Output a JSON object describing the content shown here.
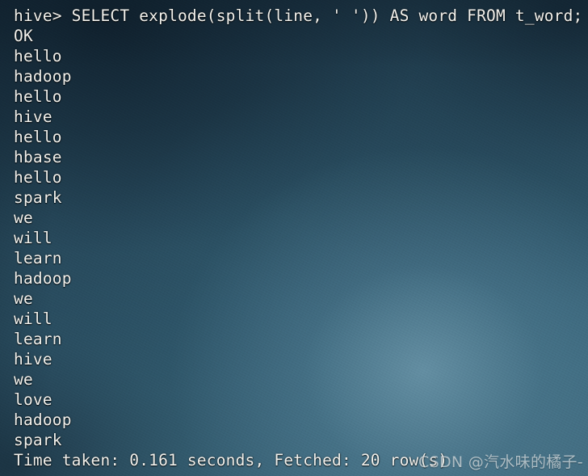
{
  "terminal": {
    "app": "hive-cli",
    "prompt": "hive>",
    "background_color": "#2f586b",
    "text_color": "#f2f1ec",
    "lines": [
      "hive> SELECT explode(split(line, ' ')) AS word FROM t_word;",
      "OK",
      "hello",
      "hadoop",
      "hello",
      "hive",
      "hello",
      "hbase",
      "hello",
      "spark",
      "we",
      "will",
      "learn",
      "hadoop",
      "we",
      "will",
      "learn",
      "hive",
      "we",
      "love",
      "hadoop",
      "spark",
      "Time taken: 0.161 seconds, Fetched: 20 row(s)"
    ],
    "query": "SELECT explode(split(line, ' ')) AS word FROM t_word;",
    "status": "OK",
    "result_words": [
      "hello",
      "hadoop",
      "hello",
      "hive",
      "hello",
      "hbase",
      "hello",
      "spark",
      "we",
      "will",
      "learn",
      "hadoop",
      "we",
      "will",
      "learn",
      "hive",
      "we",
      "love",
      "hadoop",
      "spark"
    ],
    "summary": {
      "time_taken_seconds": "0.161",
      "fetched_rows": "20",
      "text": "Time taken: 0.161 seconds, Fetched: 20 row(s)"
    }
  },
  "watermark": {
    "text": "CSDN @汽水味的橘子-",
    "color": "#d0d8dd"
  }
}
